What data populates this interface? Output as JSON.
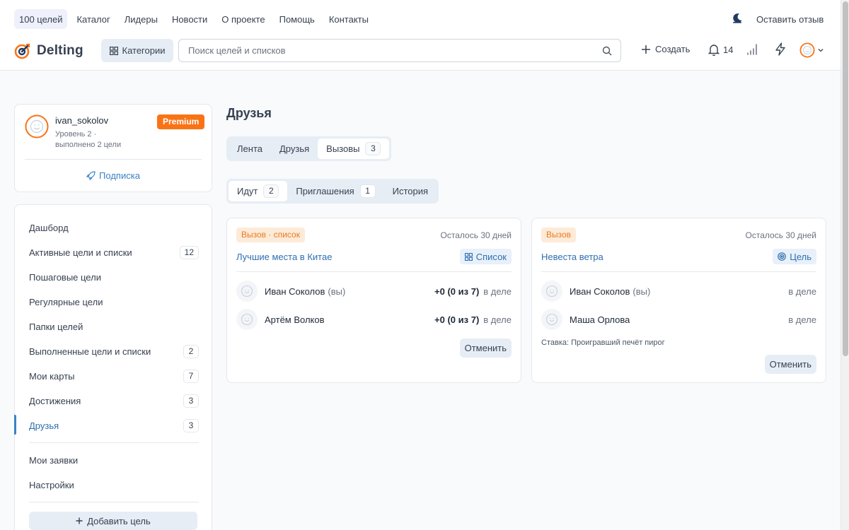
{
  "topnav": {
    "items": [
      "100 целей",
      "Каталог",
      "Лидеры",
      "Новости",
      "О проекте",
      "Помощь",
      "Контакты"
    ],
    "feedback": "Оставить отзыв"
  },
  "brand": {
    "name": "Delting",
    "accent": "#f97316"
  },
  "header": {
    "categories_label": "Категории",
    "search_placeholder": "Поиск целей и списков",
    "create_label": "Создать",
    "notifications_count": "14"
  },
  "profile": {
    "username": "ivan_sokolov",
    "level": "Уровень 2 ·",
    "completed": "выполнено 2 цели",
    "badge": "Premium",
    "subscription_label": "Подписка"
  },
  "sidebar": {
    "items": [
      {
        "label": "Дашборд",
        "count": ""
      },
      {
        "label": "Активные цели и списки",
        "count": "12"
      },
      {
        "label": "Пошаговые цели",
        "count": ""
      },
      {
        "label": "Регулярные цели",
        "count": ""
      },
      {
        "label": "Папки целей",
        "count": ""
      },
      {
        "label": "Выполненные цели и списки",
        "count": "2"
      },
      {
        "label": "Мои карты",
        "count": "7"
      },
      {
        "label": "Достижения",
        "count": "3"
      },
      {
        "label": "Друзья",
        "count": "3"
      }
    ],
    "extra": [
      {
        "label": "Мои заявки"
      },
      {
        "label": "Настройки"
      }
    ],
    "add_goal_label": "Добавить цель"
  },
  "main": {
    "title": "Друзья",
    "tabs": [
      {
        "label": "Лента",
        "count": ""
      },
      {
        "label": "Друзья",
        "count": ""
      },
      {
        "label": "Вызовы",
        "count": "3"
      }
    ],
    "subtabs": [
      {
        "label": "Идут",
        "count": "2"
      },
      {
        "label": "Приглашения",
        "count": "1"
      },
      {
        "label": "История",
        "count": ""
      }
    ]
  },
  "challenges": [
    {
      "badge": "Вызов · список",
      "remaining": "Осталось 30 дней",
      "title": "Лучшие места в Китае",
      "type_label": "Список",
      "participants": [
        {
          "name": "Иван Соколов",
          "you": "(вы)",
          "score": "+0 (0 из 7)",
          "status": "в деле"
        },
        {
          "name": "Артём Волков",
          "you": "",
          "score": "+0 (0 из 7)",
          "status": "в деле"
        }
      ],
      "stake": "",
      "cancel_label": "Отменить"
    },
    {
      "badge": "Вызов",
      "remaining": "Осталось 30 дней",
      "title": "Невеста ветра",
      "type_label": "Цель",
      "participants": [
        {
          "name": "Иван Соколов",
          "you": "(вы)",
          "score": "",
          "status": "в деле"
        },
        {
          "name": "Маша Орлова",
          "you": "",
          "score": "",
          "status": "в деле"
        }
      ],
      "stake": "Ставка: Проигравший печёт пирог",
      "cancel_label": "Отменить"
    }
  ]
}
